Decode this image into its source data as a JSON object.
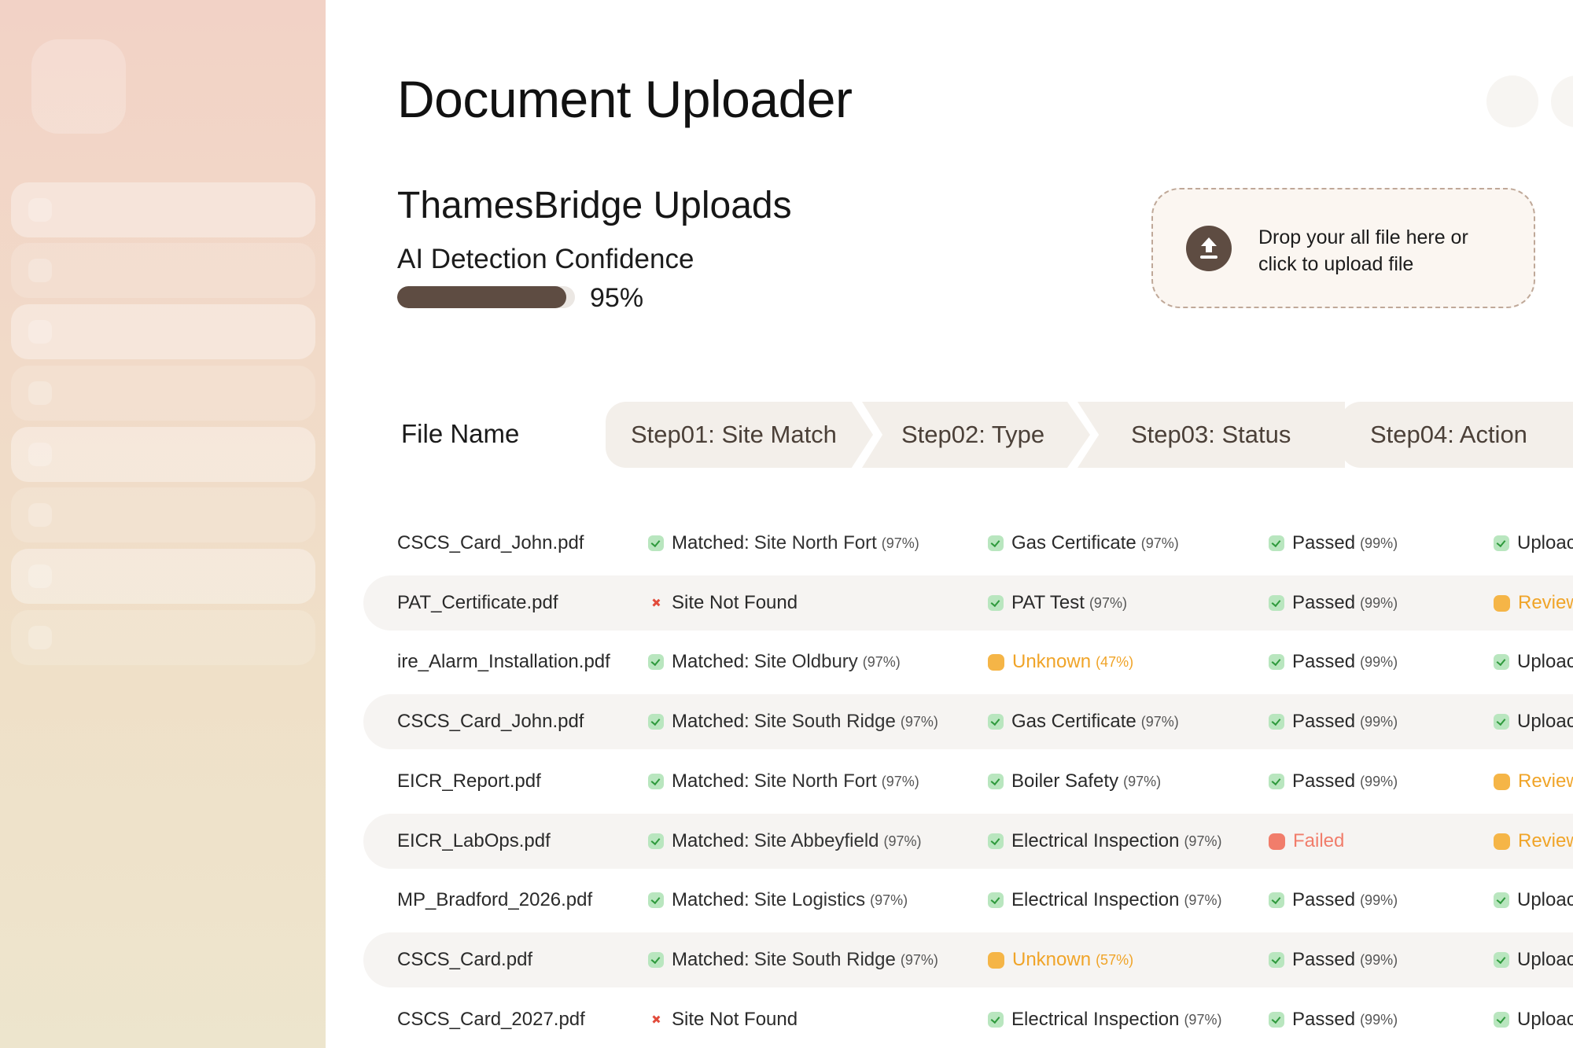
{
  "page": {
    "title": "Document Uploader"
  },
  "section": {
    "title": "ThamesBridge Uploads",
    "confidence_label": "AI Detection Confidence",
    "confidence_value": "95%",
    "confidence_fraction": 0.95
  },
  "dropzone": {
    "text": "Drop your all file here or click to upload file",
    "icon": "upload-arrow-icon"
  },
  "table": {
    "file_header": "File Name",
    "steps": [
      "Step01: Site Match",
      "Step02: Type",
      "Step03:  Status",
      "Step04: Action"
    ],
    "rows": [
      {
        "file": "CSCS_Card_John.pdf",
        "site": {
          "state": "ok",
          "label": "Matched:",
          "text": "Site North Fort",
          "pct": "(97%)"
        },
        "type": {
          "state": "ok",
          "label": "Gas Certificate",
          "pct": "(97%)"
        },
        "status": {
          "state": "ok",
          "label": "Passed",
          "pct": "(99%)"
        },
        "action": {
          "state": "ok",
          "label": "Uploac"
        }
      },
      {
        "file": "PAT_Certificate.pdf",
        "site": {
          "state": "x",
          "label": "Site Not Found",
          "text": "",
          "pct": ""
        },
        "type": {
          "state": "ok",
          "label": "PAT Test",
          "pct": "(97%)"
        },
        "status": {
          "state": "ok",
          "label": "Passed",
          "pct": "(99%)"
        },
        "action": {
          "state": "warn",
          "label": "Review"
        }
      },
      {
        "file": "ire_Alarm_Installation.pdf",
        "site": {
          "state": "ok",
          "label": "Matched:",
          "text": "Site Oldbury",
          "pct": "(97%)"
        },
        "type": {
          "state": "warn",
          "label": "Unknown",
          "pct": "(47%)"
        },
        "status": {
          "state": "ok",
          "label": "Passed",
          "pct": "(99%)"
        },
        "action": {
          "state": "ok",
          "label": "Uploac"
        }
      },
      {
        "file": "CSCS_Card_John.pdf",
        "site": {
          "state": "ok",
          "label": "Matched:",
          "text": "Site South Ridge",
          "pct": "(97%)"
        },
        "type": {
          "state": "ok",
          "label": "Gas Certificate",
          "pct": "(97%)"
        },
        "status": {
          "state": "ok",
          "label": "Passed",
          "pct": "(99%)"
        },
        "action": {
          "state": "ok",
          "label": "Uploac"
        }
      },
      {
        "file": "EICR_Report.pdf",
        "site": {
          "state": "ok",
          "label": "Matched:",
          "text": "Site North Fort",
          "pct": "(97%)"
        },
        "type": {
          "state": "ok",
          "label": "Boiler Safety",
          "pct": "(97%)"
        },
        "status": {
          "state": "ok",
          "label": "Passed",
          "pct": "(99%)"
        },
        "action": {
          "state": "warn",
          "label": "Review"
        }
      },
      {
        "file": "EICR_LabOps.pdf",
        "site": {
          "state": "ok",
          "label": "Matched:",
          "text": "Site Abbeyfield",
          "pct": "(97%)"
        },
        "type": {
          "state": "ok",
          "label": "Electrical Inspection",
          "pct": "(97%)"
        },
        "status": {
          "state": "fail",
          "label": "Failed",
          "pct": ""
        },
        "action": {
          "state": "warn",
          "label": "Review"
        }
      },
      {
        "file": "MP_Bradford_2026.pdf",
        "site": {
          "state": "ok",
          "label": "Matched:",
          "text": "Site Logistics",
          "pct": "(97%)"
        },
        "type": {
          "state": "ok",
          "label": "Electrical Inspection",
          "pct": "(97%)"
        },
        "status": {
          "state": "ok",
          "label": "Passed",
          "pct": "(99%)"
        },
        "action": {
          "state": "ok",
          "label": "Uploac"
        }
      },
      {
        "file": "CSCS_Card.pdf",
        "site": {
          "state": "ok",
          "label": "Matched:",
          "text": "Site South Ridge",
          "pct": "(97%)"
        },
        "type": {
          "state": "warn",
          "label": "Unknown",
          "pct": "(57%)"
        },
        "status": {
          "state": "ok",
          "label": "Passed",
          "pct": "(99%)"
        },
        "action": {
          "state": "ok",
          "label": "Uploac"
        }
      },
      {
        "file": "CSCS_Card_2027.pdf",
        "site": {
          "state": "x",
          "label": "Site Not Found",
          "text": "",
          "pct": ""
        },
        "type": {
          "state": "ok",
          "label": "Electrical Inspection",
          "pct": "(97%)"
        },
        "status": {
          "state": "ok",
          "label": "Passed",
          "pct": "(99%)"
        },
        "action": {
          "state": "ok",
          "label": "Uploac"
        }
      }
    ]
  },
  "colors": {
    "accent_dark": "#5e4c42",
    "ok": "#2f9a3d",
    "warn": "#f0a428",
    "fail": "#f17d6b"
  }
}
